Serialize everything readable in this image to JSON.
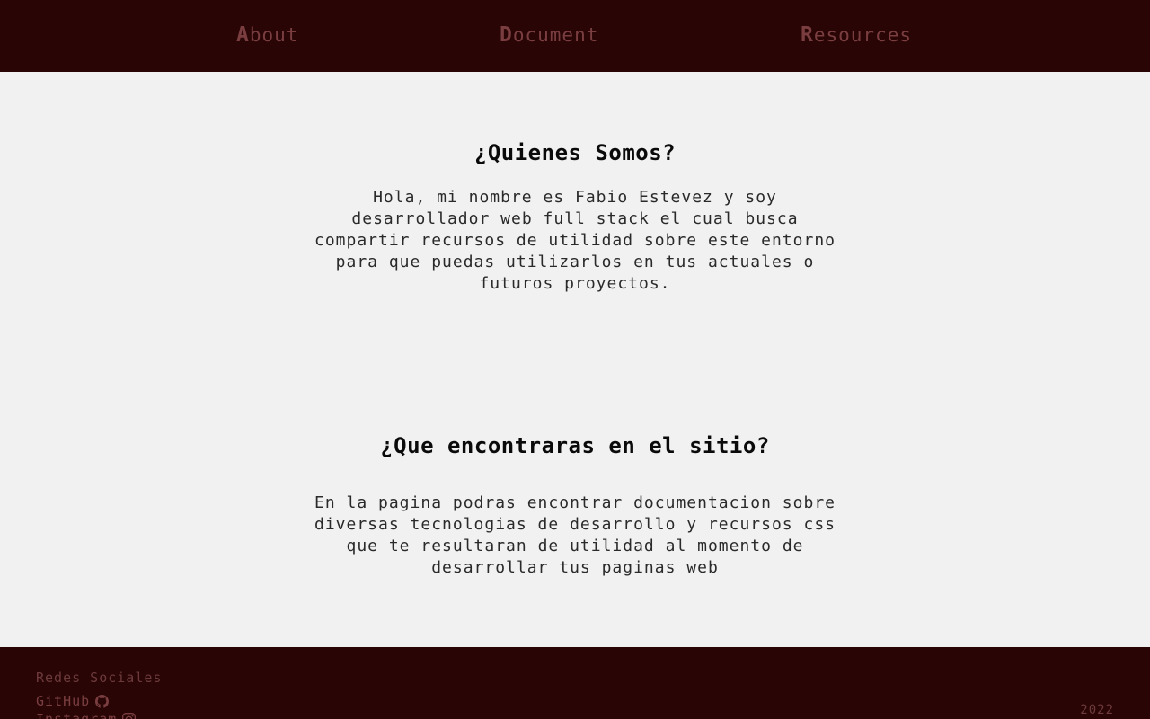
{
  "nav": {
    "about": {
      "first": "A",
      "rest": "bout"
    },
    "document": {
      "first": "D",
      "rest": "ocument"
    },
    "resources": {
      "first": "R",
      "rest": "esources"
    }
  },
  "about_section": {
    "title": "¿Quienes Somos?",
    "body": "Hola, mi nombre es Fabio Estevez y soy desarrollador web full stack el cual busca compartir recursos de utilidad sobre este entorno para que puedas utilizarlos en tus actuales o futuros proyectos."
  },
  "site_section": {
    "title": "¿Que encontraras en el sitio?",
    "body": "En la pagina podras encontrar documentacion sobre diversas tecnologias de desarrollo y recursos css que te resultaran de utilidad al momento de desarrollar tus paginas web"
  },
  "footer": {
    "title": "Redes Sociales",
    "links": [
      {
        "label": "GitHub",
        "icon": "github-icon"
      },
      {
        "label": "Instagram",
        "icon": "instagram-icon"
      }
    ],
    "year": "2022"
  },
  "colors": {
    "bar_background": "#290505",
    "link": "#7a3e40",
    "page_background": "#f1f1f1"
  }
}
